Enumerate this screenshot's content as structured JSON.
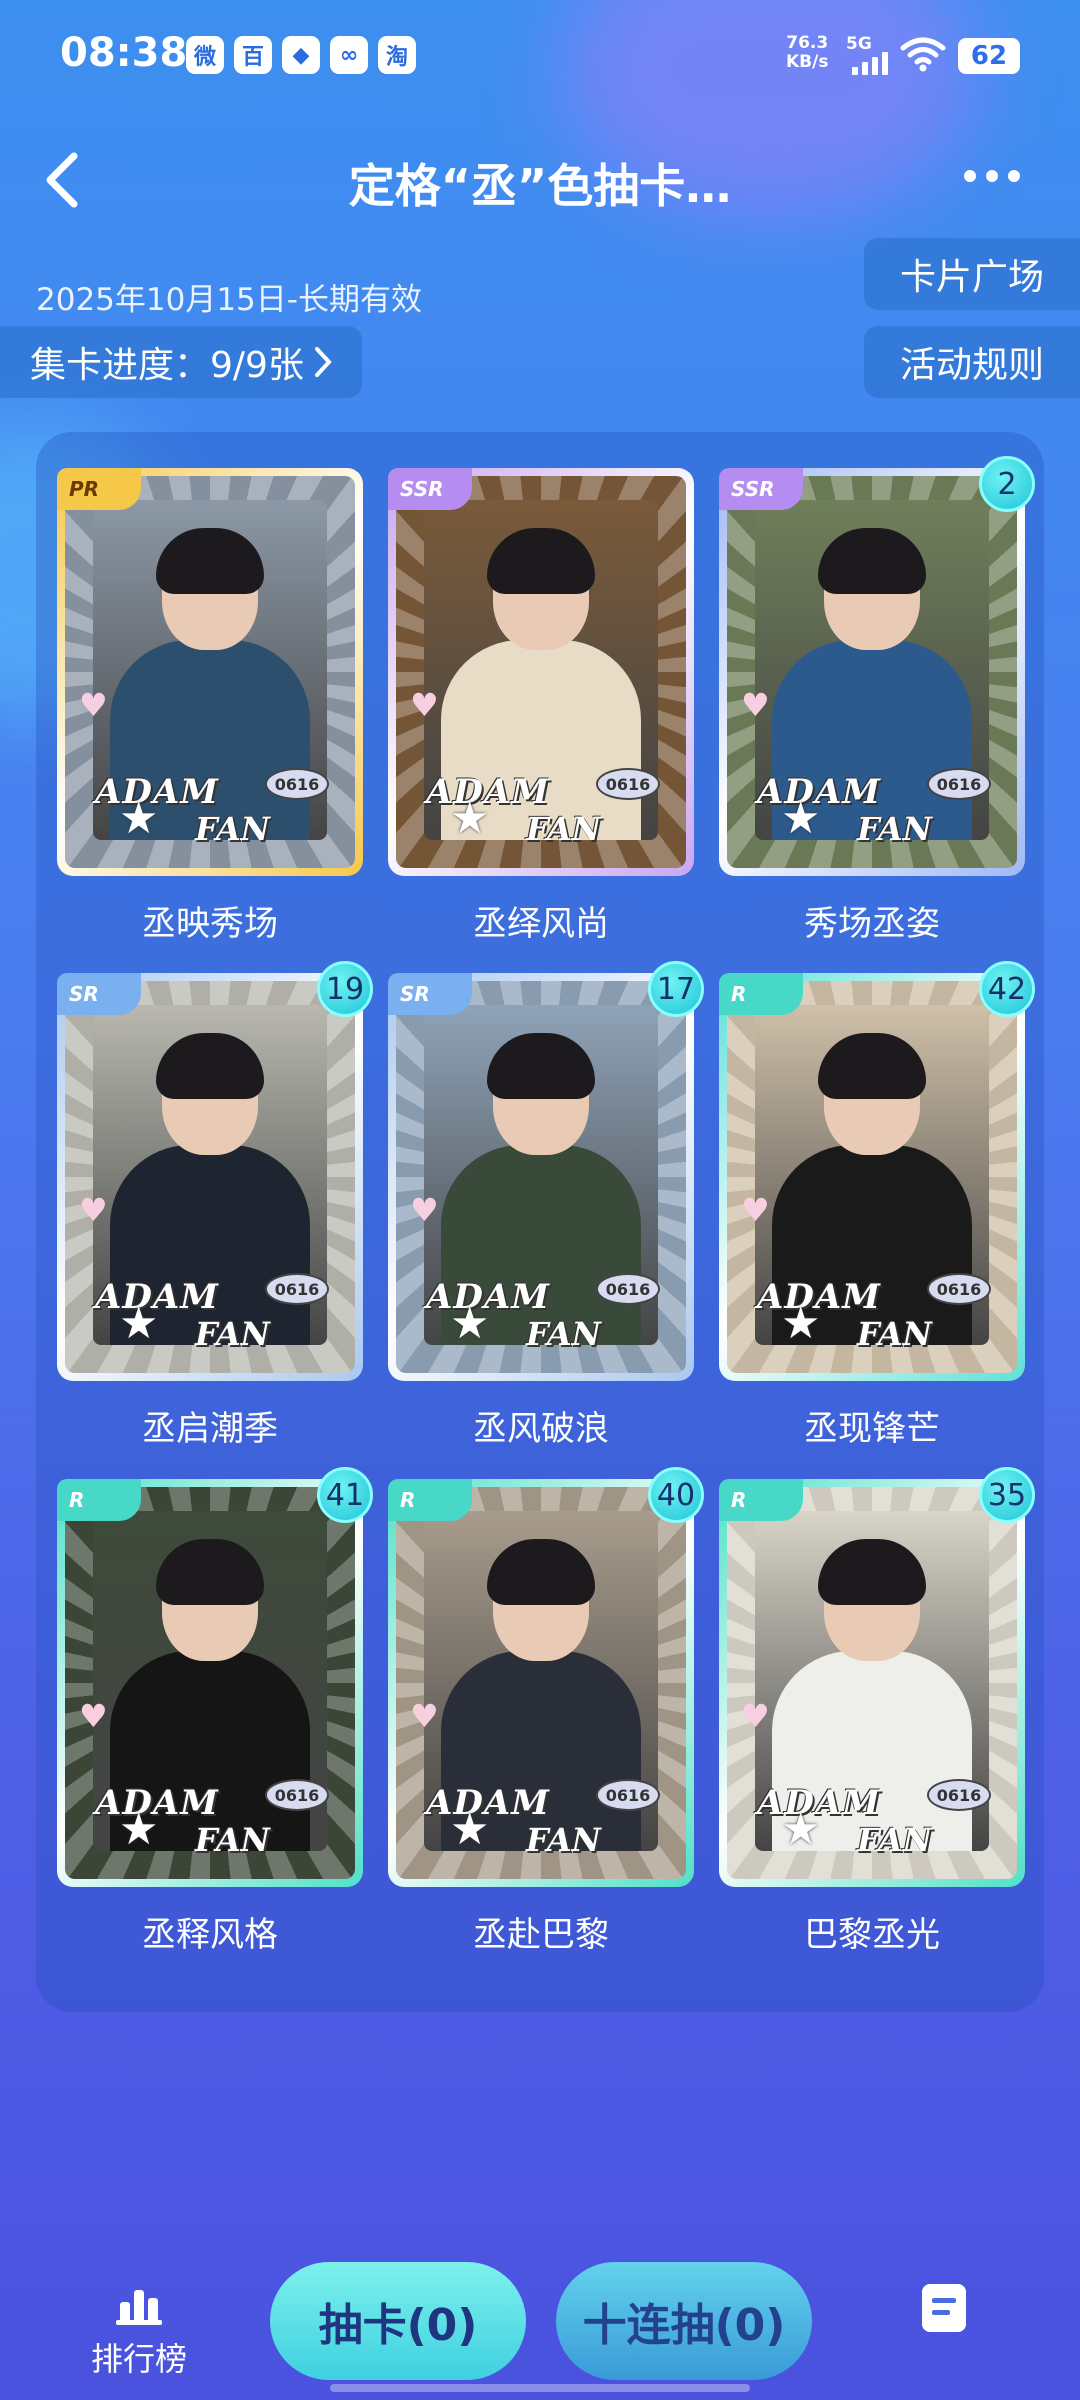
{
  "status_bar": {
    "time": "08:38",
    "app_icons": [
      "微",
      "百",
      "◆",
      "∞",
      "淘"
    ],
    "net_speed_value": "76.3",
    "net_speed_unit": "KB/s",
    "network": "5G",
    "battery": "62"
  },
  "header": {
    "title": "定格“丞”色抽卡…",
    "date": "2025年10月15日-长期有效",
    "progress_label": "集卡进度：9/9张",
    "card_plaza": "卡片广场",
    "rules": "活动规则"
  },
  "card_art": {
    "logo_top": "ADAM",
    "logo_bottom": "FAN",
    "badge": "0616"
  },
  "cards": [
    {
      "name": "丞映秀场",
      "rarity": "PR",
      "count": "",
      "frame": "#f5c84a",
      "body": "#2c4f6e",
      "bg": "#8c98a6"
    },
    {
      "name": "丞绎风尚",
      "rarity": "SSR",
      "count": "",
      "frame": "#c9a6f2",
      "body": "#e8dcc6",
      "bg": "#7a5a3a"
    },
    {
      "name": "秀场丞姿",
      "rarity": "SSR",
      "count": "2",
      "frame": "#9fb8f5",
      "body": "#2c5a8c",
      "bg": "#6f7f5a"
    },
    {
      "name": "丞启潮季",
      "rarity": "SR",
      "count": "19",
      "frame": "#a8c8f0",
      "body": "#1e2430",
      "bg": "#b8b8b0"
    },
    {
      "name": "丞风破浪",
      "rarity": "SR",
      "count": "17",
      "frame": "#a8c8f0",
      "body": "#3a4a3a",
      "bg": "#8fa3b8"
    },
    {
      "name": "丞现锋芒",
      "rarity": "R",
      "count": "42",
      "frame": "#5fe0d8",
      "body": "#1a1a1a",
      "bg": "#cfc0a8"
    },
    {
      "name": "丞释风格",
      "rarity": "R",
      "count": "41",
      "frame": "#4fe0c8",
      "body": "#151515",
      "bg": "#3e4a3a"
    },
    {
      "name": "丞赴巴黎",
      "rarity": "R",
      "count": "40",
      "frame": "#4fe0c8",
      "body": "#2a2e38",
      "bg": "#a89c8c"
    },
    {
      "name": "巴黎丞光",
      "rarity": "R",
      "count": "35",
      "frame": "#4fe0c8",
      "body": "#eeeeea",
      "bg": "#d8d4c8"
    }
  ],
  "bottom": {
    "rank_label": "排行榜",
    "draw_button": "抽卡(0)",
    "ten_draw_button": "十连抽(0)"
  },
  "colors": {
    "accent_cyan": "#3fd0e0",
    "pr_badge": "#f5c84a",
    "ssr_badge": "#b58cf0",
    "sr_badge": "#7ab0f0",
    "r_badge": "#48d8c8"
  }
}
